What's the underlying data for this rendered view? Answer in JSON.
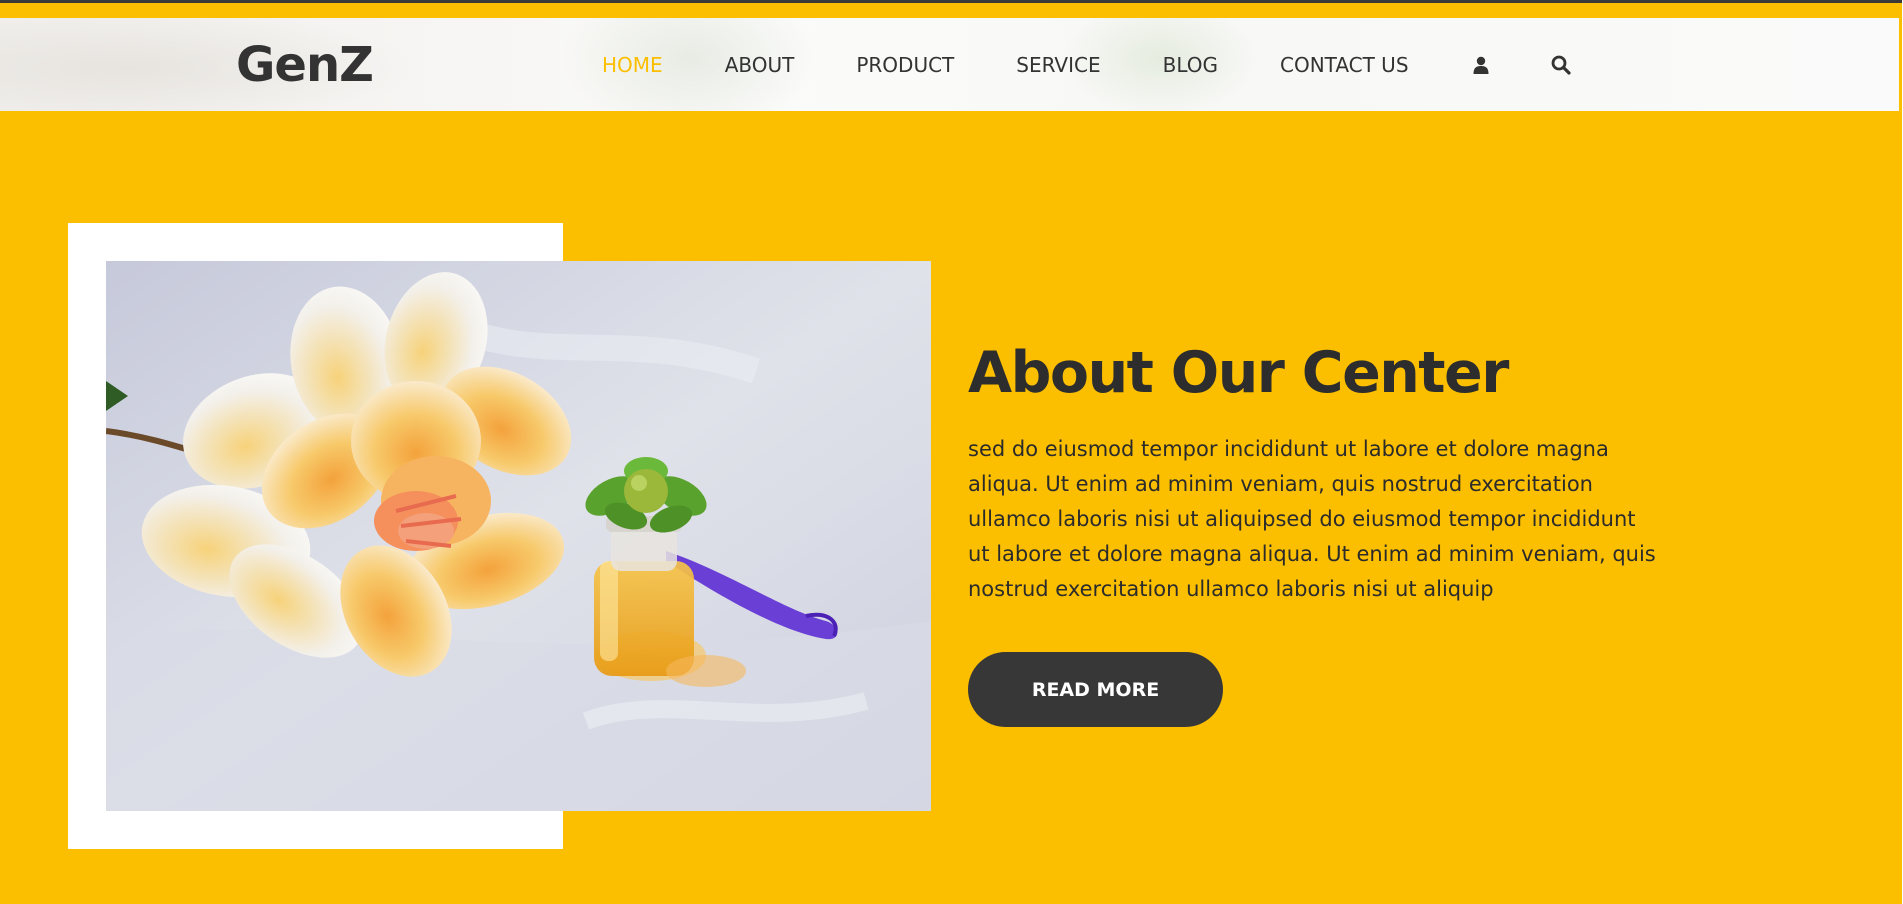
{
  "header": {
    "logo": "GenZ",
    "nav": [
      {
        "label": "HOME",
        "active": true
      },
      {
        "label": "ABOUT",
        "active": false
      },
      {
        "label": "PRODUCT",
        "active": false
      },
      {
        "label": "SERVICE",
        "active": false
      },
      {
        "label": "BLOG",
        "active": false
      },
      {
        "label": "CONTACT US",
        "active": false
      }
    ],
    "icons": [
      "user-icon",
      "search-icon"
    ]
  },
  "about": {
    "title": "About Our Center",
    "text": "sed do eiusmod tempor incididunt ut labore et dolore magna aliqua. Ut enim ad minim veniam, quis nostrud exercitation ullamco laboris nisi ut aliquipsed do eiusmod tempor incididunt ut labore et dolore magna aliqua. Ut enim ad minim veniam, quis nostrud exercitation ullamco laboris nisi ut aliquip",
    "button_label": "READ MORE"
  },
  "colors": {
    "accent": "#fbbf00",
    "dark": "#373737",
    "text": "#2b2b2b"
  }
}
